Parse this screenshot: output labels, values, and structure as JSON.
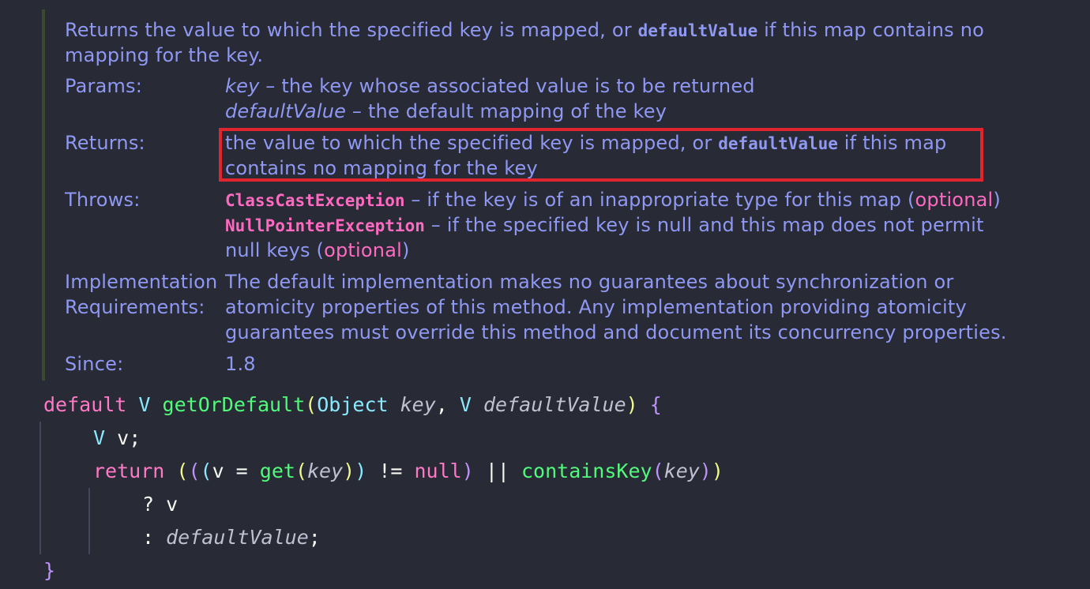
{
  "doc": {
    "summary_line1_pre": "Returns the value to which the specified key is mapped, or ",
    "summary_code": "defaultValue",
    "summary_line1_post": " if this map contains no",
    "summary_line2": "mapping for the key.",
    "params_label": "Params:",
    "param1_name": "key",
    "param1_desc": " – the key whose associated value is to be returned",
    "param2_name": "defaultValue",
    "param2_desc": " – the default mapping of the key",
    "returns_label": "Returns:",
    "returns_line1_pre": "the value to which the specified key is mapped, or ",
    "returns_code": "defaultValue",
    "returns_line1_post": " if this map",
    "returns_line2": "contains no mapping for the key",
    "throws_label": "Throws:",
    "throws1_exc": "ClassCastException",
    "throws1_desc": " – if the key is of an inappropriate type for this map (",
    "throws1_opt": "optional",
    "throws1_end": ")",
    "throws2_exc": "NullPointerException",
    "throws2_desc": " – if the specified key is null and this map does not permit",
    "throws2_line2_pre": "null keys (",
    "throws2_opt": "optional",
    "throws2_end": ")",
    "impl_label1": "Implementation",
    "impl_label2": "Requirements:",
    "impl_line1": "The default implementation makes no guarantees about synchronization or",
    "impl_line2": "atomicity properties of this method. Any implementation providing atomicity",
    "impl_line3": "guarantees must override this method and document its concurrency properties.",
    "since_label": "Since:",
    "since_value": "1.8"
  },
  "code": {
    "kw_default": "default",
    "type_v": "V",
    "method_name": "getOrDefault",
    "type_object": "Object",
    "param_key": "key",
    "param_default": "defaultValue",
    "var_v": "v",
    "kw_return": "return",
    "call_get": "get",
    "kw_null": "null",
    "call_contains": "containsKey",
    "question": "?",
    "colon": ":"
  },
  "colors": {
    "background": "#282a36",
    "doc_text": "#8f98f2",
    "exception": "#ff6ac1",
    "highlight_border": "#e0252f",
    "keyword": "#ff79c6",
    "type": "#8be9fd",
    "function": "#50fa7b"
  }
}
